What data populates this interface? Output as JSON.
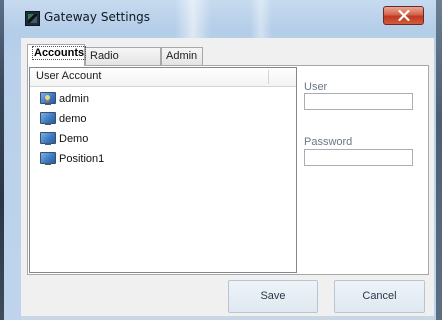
{
  "window": {
    "title": "Gateway Settings",
    "close_symbol": "x"
  },
  "tabs": [
    {
      "label": "Accounts",
      "active": true
    },
    {
      "label": "Radio Aliases",
      "active": false
    },
    {
      "label": "Admin",
      "active": false
    }
  ],
  "accounts_list": {
    "column_header": "User Account",
    "items": [
      {
        "label": "admin",
        "icon": "admin-user-monitor-icon"
      },
      {
        "label": "demo",
        "icon": "monitor-icon"
      },
      {
        "label": "Demo",
        "icon": "monitor-icon"
      },
      {
        "label": "Position1",
        "icon": "monitor-icon"
      }
    ]
  },
  "form": {
    "user_label": "User",
    "user_value": "",
    "password_label": "Password",
    "password_value": ""
  },
  "buttons": {
    "save_label": "Save",
    "cancel_label": "Cancel"
  },
  "colors": {
    "close_button": "#c0391f",
    "field_label": "#6a7787",
    "icon_blue": "#3e7cc2"
  }
}
